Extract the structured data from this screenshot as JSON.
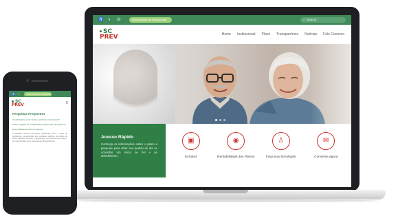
{
  "desktop": {
    "topbar": {
      "icons": [
        "accessibility-icon",
        "contrast-icon",
        "phone-icon"
      ],
      "service_pill": "Atendimento ao Participante",
      "search_placeholder": "Buscar"
    },
    "logo": {
      "line1": "SC",
      "line2": "PREV"
    },
    "nav": [
      "Home",
      "Institucional",
      "Plano",
      "Transparência",
      "Notícias",
      "Fale Conosco"
    ],
    "acesso": {
      "title": "Acesso Rápido",
      "text": "Conheça os informações sobre o plano e pesquise para obter seu pedido de dia ou consultar um único ao fiel e ao atendimento."
    },
    "quick_links": [
      {
        "label": "Extratos",
        "icon": "wallet-icon",
        "glyph": "▣"
      },
      {
        "label": "Rentabilidade dos Planos",
        "icon": "money-eye-icon",
        "glyph": "◉"
      },
      {
        "label": "Faça sua Simulação",
        "icon": "user-icon",
        "glyph": "♙"
      },
      {
        "label": "Converse agora",
        "icon": "chat-icon",
        "glyph": "✉"
      }
    ]
  },
  "mobile": {
    "service_pill": "Atendimento ao Participante",
    "logo": {
      "line1": "SC",
      "line2": "PREV"
    },
    "menu_glyph": "≡",
    "section_title": "Perguntas Frequentes",
    "faq": [
      "O participante pode mudar o perfil de investimento?",
      "Posso resgatar as contribuições quando sair da empresa?",
      "Qual a diferença entre os planos?"
    ],
    "paragraph": "A SCPREV oferece informações detalhadas sobre o plano de previdência complementar dos servidores públicos do Estado de Santa Catarina. Consulte o regulamento, acompanhe seu extrato e tire suas dúvidas com a nossa equipe de atendimento."
  },
  "colors": {
    "brand_green": "#2f7f47",
    "topbar_green": "#3f8a58",
    "accent_red": "#c7332b",
    "device_frame": "#1e1f22"
  }
}
